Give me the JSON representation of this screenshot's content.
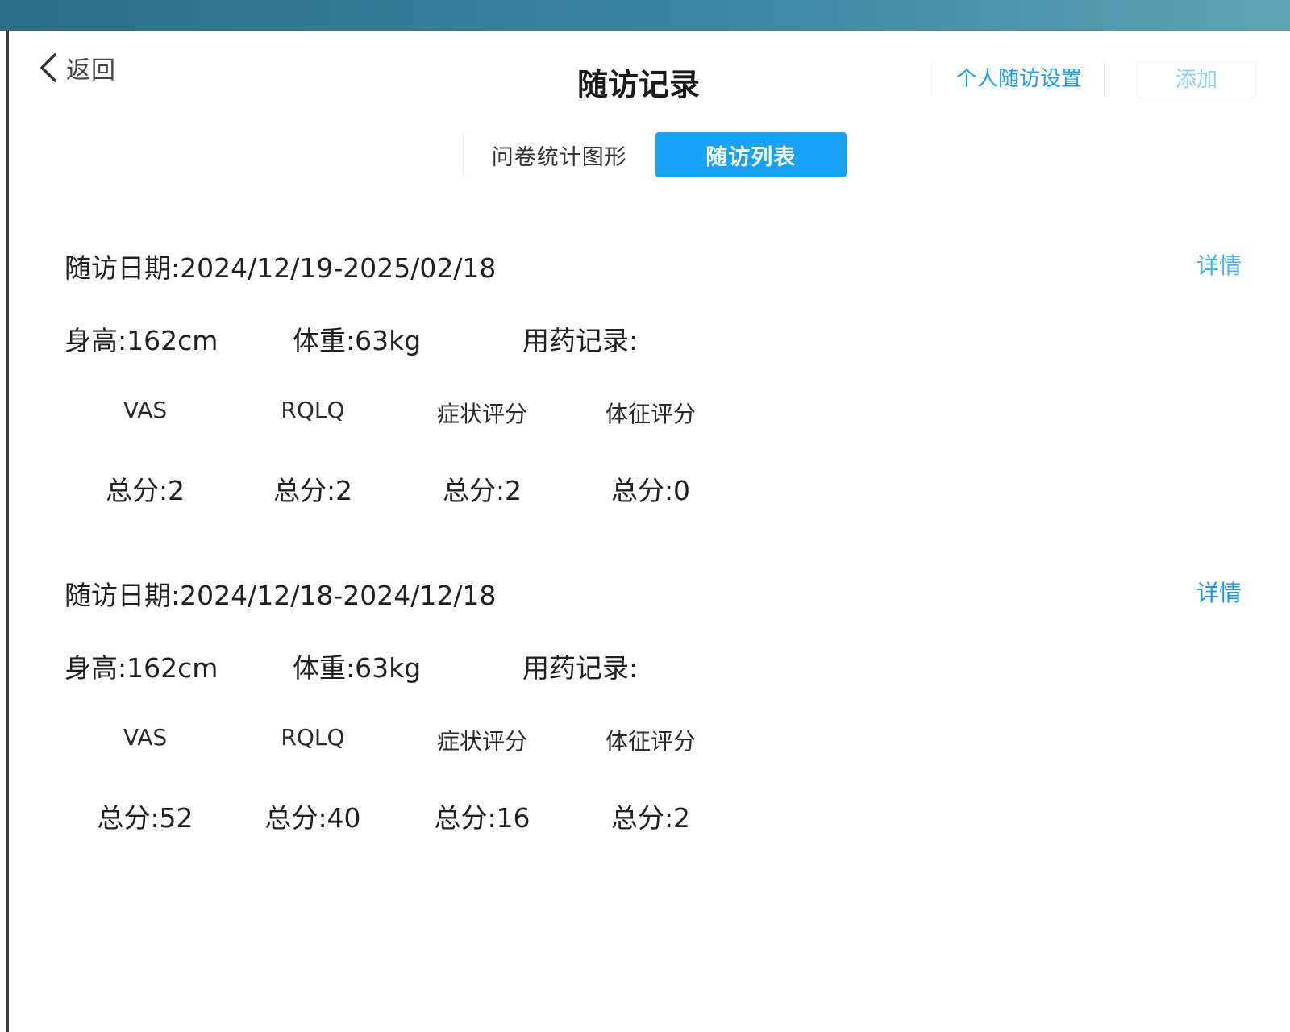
{
  "header": {
    "back_label": "返回",
    "title": "随访记录",
    "personal_settings_label": "个人随访设置",
    "add_label": "添加"
  },
  "tabs": [
    {
      "label": "问卷统计图形",
      "active": false
    },
    {
      "label": "随访列表",
      "active": true
    }
  ],
  "colors": {
    "accent": "#16a3f5",
    "link": "#1596e8"
  },
  "records": [
    {
      "date": "随访日期:2024/12/19-2025/02/18",
      "detail_label": "详情",
      "height": "身高:162cm",
      "weight": "体重:63kg",
      "medication": "用药记录:",
      "score_headers": [
        "VAS",
        "RQLQ",
        "症状评分",
        "体征评分"
      ],
      "score_values": [
        "总分:2",
        "总分:2",
        "总分:2",
        "总分:0"
      ]
    },
    {
      "date": "随访日期:2024/12/18-2024/12/18",
      "detail_label": "详情",
      "height": "身高:162cm",
      "weight": "体重:63kg",
      "medication": "用药记录:",
      "score_headers": [
        "VAS",
        "RQLQ",
        "症状评分",
        "体征评分"
      ],
      "score_values": [
        "总分:52",
        "总分:40",
        "总分:16",
        "总分:2"
      ]
    }
  ]
}
